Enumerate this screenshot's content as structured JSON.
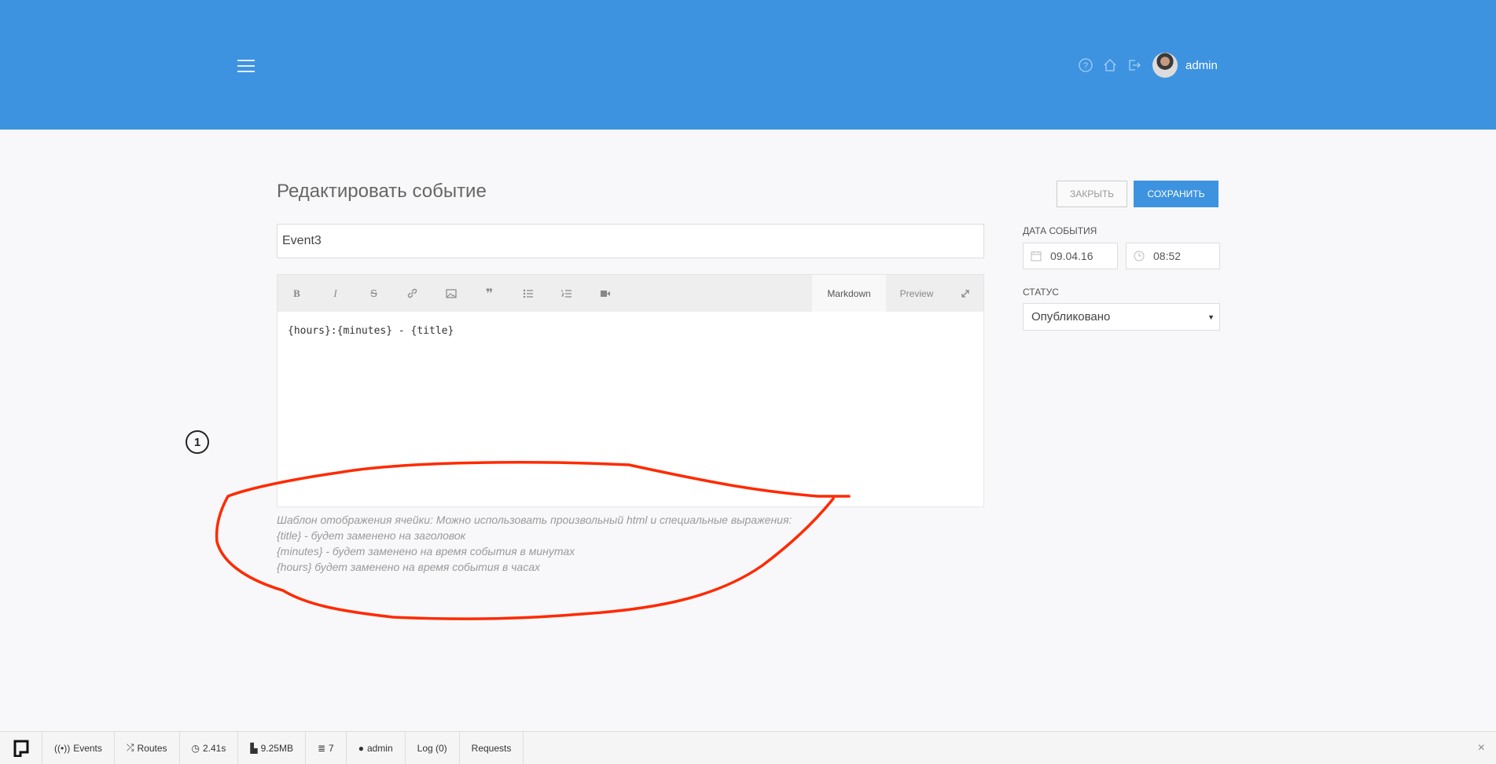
{
  "header": {
    "username": "admin",
    "icons": [
      "help-icon",
      "home-icon",
      "logout-icon"
    ]
  },
  "main": {
    "page_title": "Редактировать событие",
    "close_label": "Закрыть",
    "save_label": "Сохранить",
    "title_value": "Event3",
    "editor": {
      "tools": [
        "bold",
        "italic",
        "strikethrough",
        "link",
        "image",
        "quote",
        "unordered-list",
        "ordered-list",
        "video"
      ],
      "tab_markdown": "Markdown",
      "tab_preview": "Preview",
      "content": "{hours}:{minutes} - {title}"
    },
    "help_lines": [
      "Шаблон отображения ячейки: Можно использовать произвольный html и специальные выражения:",
      "{title} - будет заменено на заголовок",
      "{minutes} - будет заменено на время события в минутах",
      "{hours} будет заменено на время события в часах"
    ]
  },
  "sidebar": {
    "date_label": "Дата события",
    "date_value": "09.04.16",
    "time_value": "08:52",
    "status_label": "Статус",
    "status_value": "Опубликовано"
  },
  "annotation": {
    "number": "1",
    "color": "#ff2a00"
  },
  "debugbar": {
    "items": [
      "Events",
      "Routes",
      "2.41s",
      "9.25MB",
      "7",
      "admin",
      "Log (0)",
      "Requests"
    ]
  },
  "colors": {
    "accent": "#3d93e0"
  }
}
